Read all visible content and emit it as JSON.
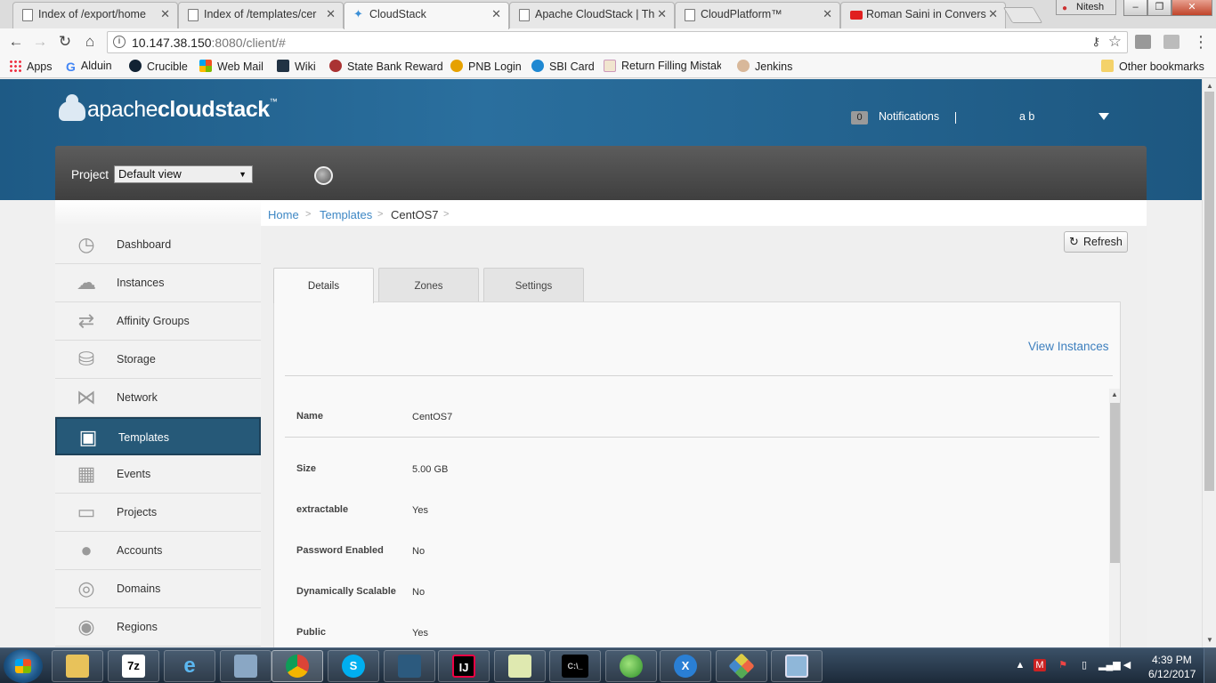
{
  "browser": {
    "tabs": [
      {
        "title": "Index of /export/home",
        "icon": "page-icon",
        "active": false
      },
      {
        "title": "Index of /templates/cer",
        "icon": "page-icon",
        "active": false
      },
      {
        "title": "CloudStack",
        "icon": "cloudstack-icon",
        "active": true
      },
      {
        "title": "Apache CloudStack | Th",
        "icon": "page-icon",
        "active": false
      },
      {
        "title": "CloudPlatform™",
        "icon": "page-icon",
        "active": false
      },
      {
        "title": "Roman Saini in Convers",
        "icon": "youtube-icon",
        "active": false
      }
    ],
    "profile_name": "Nitesh",
    "url_host": "10.147.38.150",
    "url_rest": ":8080/client/#",
    "bookmarks": [
      {
        "label": "Apps",
        "icon": "apps-grid-icon"
      },
      {
        "label": "Alduin",
        "icon": "google-icon"
      },
      {
        "label": "Crucible",
        "icon": "crucible-icon"
      },
      {
        "label": "Web Mail",
        "icon": "windows-logo-icon"
      },
      {
        "label": "Wiki",
        "icon": "wiki-icon"
      },
      {
        "label": "State Bank Reward",
        "icon": "sbi-reward-icon"
      },
      {
        "label": "PNB Login",
        "icon": "pnb-icon"
      },
      {
        "label": "SBI Card",
        "icon": "sbi-card-icon"
      },
      {
        "label": "Return Filling Mistake",
        "icon": "et-icon"
      },
      {
        "label": "Jenkins",
        "icon": "jenkins-icon"
      }
    ],
    "other_bookmarks": "Other bookmarks"
  },
  "header": {
    "logo_light": "apache",
    "logo_bold": "cloudstack",
    "logo_tm": "™",
    "notification_count": "0",
    "notifications_label": "Notifications",
    "user_name": "a b",
    "project_label": "Project",
    "project_selected": "Default view"
  },
  "sidebar": {
    "items": [
      {
        "label": "Dashboard",
        "icon": "dashboard-icon",
        "active": false
      },
      {
        "label": "Instances",
        "icon": "cloud-icon",
        "active": false
      },
      {
        "label": "Affinity Groups",
        "icon": "affinity-icon",
        "active": false
      },
      {
        "label": "Storage",
        "icon": "storage-icon",
        "active": false
      },
      {
        "label": "Network",
        "icon": "network-icon",
        "active": false
      },
      {
        "label": "Templates",
        "icon": "templates-icon",
        "active": true
      },
      {
        "label": "Events",
        "icon": "calendar-icon",
        "active": false
      },
      {
        "label": "Projects",
        "icon": "folder-icon",
        "active": false
      },
      {
        "label": "Accounts",
        "icon": "user-icon",
        "active": false
      },
      {
        "label": "Domains",
        "icon": "domains-icon",
        "active": false
      },
      {
        "label": "Regions",
        "icon": "globe-icon",
        "active": false
      }
    ]
  },
  "breadcrumb": {
    "home": "Home",
    "templates": "Templates",
    "current": "CentOS7",
    "sep": ">"
  },
  "main": {
    "refresh_label": "Refresh",
    "tabs": [
      {
        "label": "Details",
        "active": true
      },
      {
        "label": "Zones",
        "active": false
      },
      {
        "label": "Settings",
        "active": false
      }
    ],
    "view_instances": "View Instances",
    "details": [
      {
        "label": "Name",
        "value": "CentOS7"
      },
      {
        "label": "Size",
        "value": "5.00 GB"
      },
      {
        "label": "extractable",
        "value": "Yes"
      },
      {
        "label": "Password Enabled",
        "value": "No"
      },
      {
        "label": "Dynamically Scalable",
        "value": "No"
      },
      {
        "label": "Public",
        "value": "Yes"
      }
    ]
  },
  "taskbar": {
    "items": [
      {
        "icon": "file-explorer-icon",
        "glyph": ""
      },
      {
        "icon": "7zip-icon",
        "glyph": "7z"
      },
      {
        "icon": "internet-explorer-icon",
        "glyph": "e"
      },
      {
        "icon": "network-tool-icon",
        "glyph": ""
      },
      {
        "icon": "chrome-icon",
        "glyph": ""
      },
      {
        "icon": "skype-icon",
        "glyph": "S"
      },
      {
        "icon": "mysql-workbench-icon",
        "glyph": ""
      },
      {
        "icon": "intellij-icon",
        "glyph": "IJ"
      },
      {
        "icon": "notepad-plus-icon",
        "glyph": ""
      },
      {
        "icon": "cmd-icon",
        "glyph": "C:\\_"
      },
      {
        "icon": "green-globe-icon",
        "glyph": ""
      },
      {
        "icon": "xmanager-icon",
        "glyph": "X"
      },
      {
        "icon": "git-icon",
        "glyph": ""
      },
      {
        "icon": "remote-desktop-icon",
        "glyph": ""
      }
    ],
    "time": "4:39 PM",
    "date": "6/12/2017"
  }
}
